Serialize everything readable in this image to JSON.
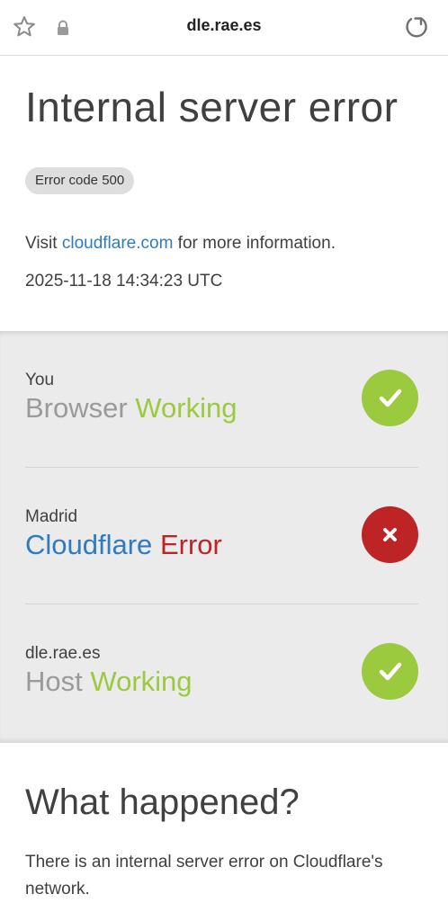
{
  "browser": {
    "url": "dle.rae.es",
    "icons": {
      "favorite": "star-icon",
      "security": "lock-icon",
      "reload": "reload-icon"
    }
  },
  "header": {
    "title": "Internal server error",
    "error_badge": "Error code 500",
    "visit_prefix": "Visit ",
    "visit_link": "cloudflare.com",
    "visit_suffix": " for more information.",
    "timestamp": "2025-11-18 14:34:23 UTC"
  },
  "status": {
    "rows": [
      {
        "location": "You",
        "name": "Browser",
        "state": "Working",
        "icon": "check-icon"
      },
      {
        "location": "Madrid",
        "name": "Cloudflare",
        "state": "Error",
        "icon": "x-icon"
      },
      {
        "location": "dle.rae.es",
        "name": "Host",
        "state": "Working",
        "icon": "check-icon"
      }
    ]
  },
  "what_happened": {
    "title": "What happened?",
    "text": "There is an internal server error on Cloudflare's network."
  },
  "colors": {
    "working": "#9bca3e",
    "error": "#bd2426",
    "link": "#2f7bbf",
    "status_bg": "#ebebeb"
  }
}
